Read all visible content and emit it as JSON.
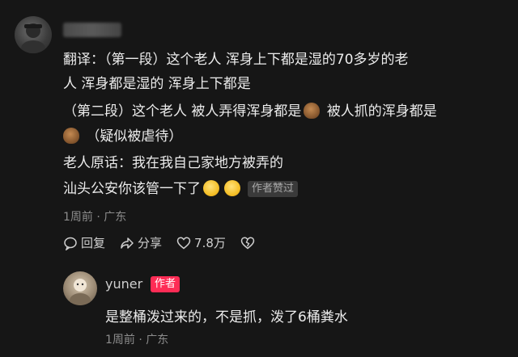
{
  "comment": {
    "lines": [
      "翻译：（第一段）这个老人 浑身上下都是湿的70多岁的老",
      "人 浑身都是湿的 浑身上下都是",
      "（第二段）这个老人 被人弄得浑身都是",
      "被人抓的浑身都是",
      "（疑似被虐待）",
      "老人原话：我在我自己家地方被弄的",
      "汕头公安你该管一下了"
    ],
    "liked_badge": "作者赞过",
    "meta": "1周前 · 广东",
    "actions": {
      "reply": "回复",
      "share": "分享",
      "likes": "7.8万"
    }
  },
  "reply": {
    "username": "yuner",
    "badge": "作者",
    "text": "是整桶泼过来的，不是抓，泼了6桶粪水",
    "meta": "1周前 · 广东"
  },
  "icons": {
    "emoji_poop": "pile-of-poo-emoji",
    "emoji_pleading": "pleading-face-emoji"
  }
}
